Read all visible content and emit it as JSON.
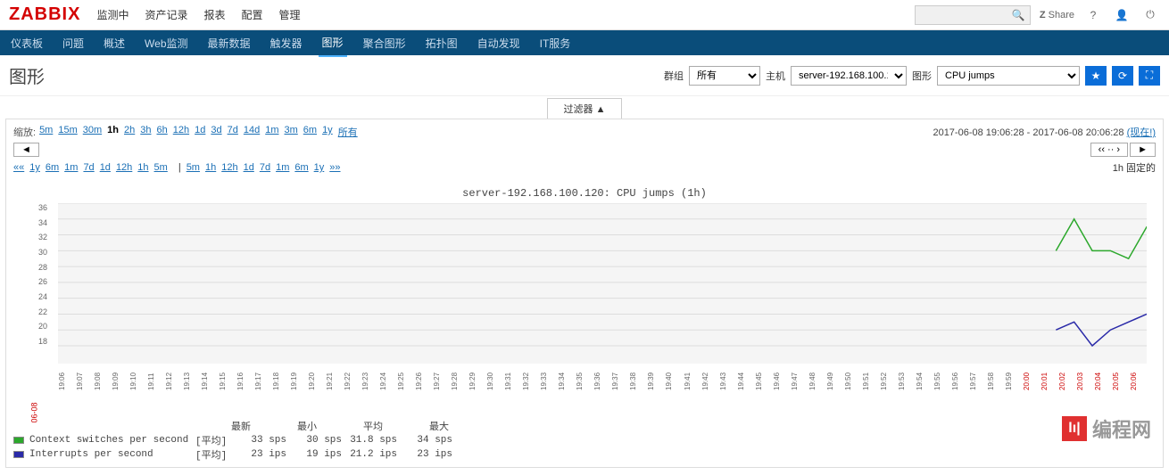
{
  "logo": "ZABBIX",
  "topnav": [
    "监测中",
    "资产记录",
    "报表",
    "配置",
    "管理"
  ],
  "share": "Share",
  "subnav": [
    "仪表板",
    "问题",
    "概述",
    "Web监测",
    "最新数据",
    "触发器",
    "图形",
    "聚合图形",
    "拓扑图",
    "自动发现",
    "IT服务"
  ],
  "subnav_active": 6,
  "page_title": "图形",
  "filters": {
    "group_lbl": "群组",
    "group_val": "所有",
    "host_lbl": "主机",
    "host_val": "server-192.168.100.120",
    "graph_lbl": "图形",
    "graph_val": "CPU jumps"
  },
  "filter_tab": "过滤器  ▲",
  "zoom_lbl": "缩放:",
  "zoom_links": [
    "5m",
    "15m",
    "30m",
    "1h",
    "2h",
    "3h",
    "6h",
    "12h",
    "1d",
    "3d",
    "7d",
    "14d",
    "1m",
    "3m",
    "6m",
    "1y",
    "所有"
  ],
  "zoom_bold": "1h",
  "timerange_from": "2017-06-08 19:06:28",
  "timerange_to": "2017-06-08 20:06:28",
  "timerange_now": "(现在!)",
  "nav_left": "◄",
  "nav_dots": "‹‹ ·· ›",
  "nav_right": "►",
  "links_left": [
    "««",
    "1y",
    "6m",
    "1m",
    "7d",
    "1d",
    "12h",
    "1h",
    "5m"
  ],
  "links_sep": "|",
  "links_right": [
    "5m",
    "1h",
    "12h",
    "1d",
    "7d",
    "1m",
    "6m",
    "1y",
    "»»"
  ],
  "fixed_lbl": "1h  固定的",
  "chart_title": "server-192.168.100.120: CPU jumps (1h)",
  "chart_data": {
    "type": "line",
    "title": "server-192.168.100.120: CPU jumps (1h)",
    "ylabel": "",
    "ylim": [
      18,
      36
    ],
    "yticks": [
      36,
      34,
      32,
      30,
      28,
      26,
      24,
      22,
      20,
      18
    ],
    "x_start": "06-08 19:06",
    "x_end": "06-08 20:06",
    "xticks": [
      "19:06",
      "19:07",
      "19:08",
      "19:09",
      "19:10",
      "19:11",
      "19:12",
      "19:13",
      "19:14",
      "19:15",
      "19:16",
      "19:17",
      "19:18",
      "19:19",
      "19:20",
      "19:21",
      "19:22",
      "19:23",
      "19:24",
      "19:25",
      "19:26",
      "19:27",
      "19:28",
      "19:29",
      "19:30",
      "19:31",
      "19:32",
      "19:33",
      "19:34",
      "19:35",
      "19:36",
      "19:37",
      "19:38",
      "19:39",
      "19:40",
      "19:41",
      "19:42",
      "19:43",
      "19:44",
      "19:45",
      "19:46",
      "19:47",
      "19:48",
      "19:49",
      "19:50",
      "19:51",
      "19:52",
      "19:53",
      "19:54",
      "19:55",
      "19:56",
      "19:57",
      "19:58",
      "19:59",
      "20:00",
      "20:01",
      "20:02",
      "20:03",
      "20:04",
      "20:05",
      "20:06"
    ],
    "xticks_red": [
      "20:00",
      "20:01",
      "20:02",
      "20:03",
      "20:04",
      "20:05",
      "20:06"
    ],
    "series": [
      {
        "name": "Context switches per second",
        "color": "#2ca82c",
        "visible_x": [
          55,
          56,
          57,
          58,
          59,
          60,
          61
        ],
        "visible_y": [
          30,
          34,
          30,
          30,
          29,
          33,
          33
        ]
      },
      {
        "name": "Interrupts per second",
        "color": "#2a2aa8",
        "visible_x": [
          55,
          56,
          57,
          58,
          59,
          60,
          61
        ],
        "visible_y": [
          20,
          21,
          18,
          20,
          21,
          22,
          22
        ]
      }
    ]
  },
  "legend_headers": [
    "最新",
    "最小",
    "平均",
    "最大"
  ],
  "legend_rows": [
    {
      "color": "#2ca82c",
      "name": "Context switches per second",
      "mode": "[平均]",
      "vals": [
        "33 sps",
        "30 sps",
        "31.8 sps",
        "34 sps"
      ]
    },
    {
      "color": "#2a2aa8",
      "name": "Interrupts per second",
      "mode": "[平均]",
      "vals": [
        "23 ips",
        "19 ips",
        "21.2 ips",
        "23 ips"
      ]
    }
  ],
  "watermark": "编程网"
}
